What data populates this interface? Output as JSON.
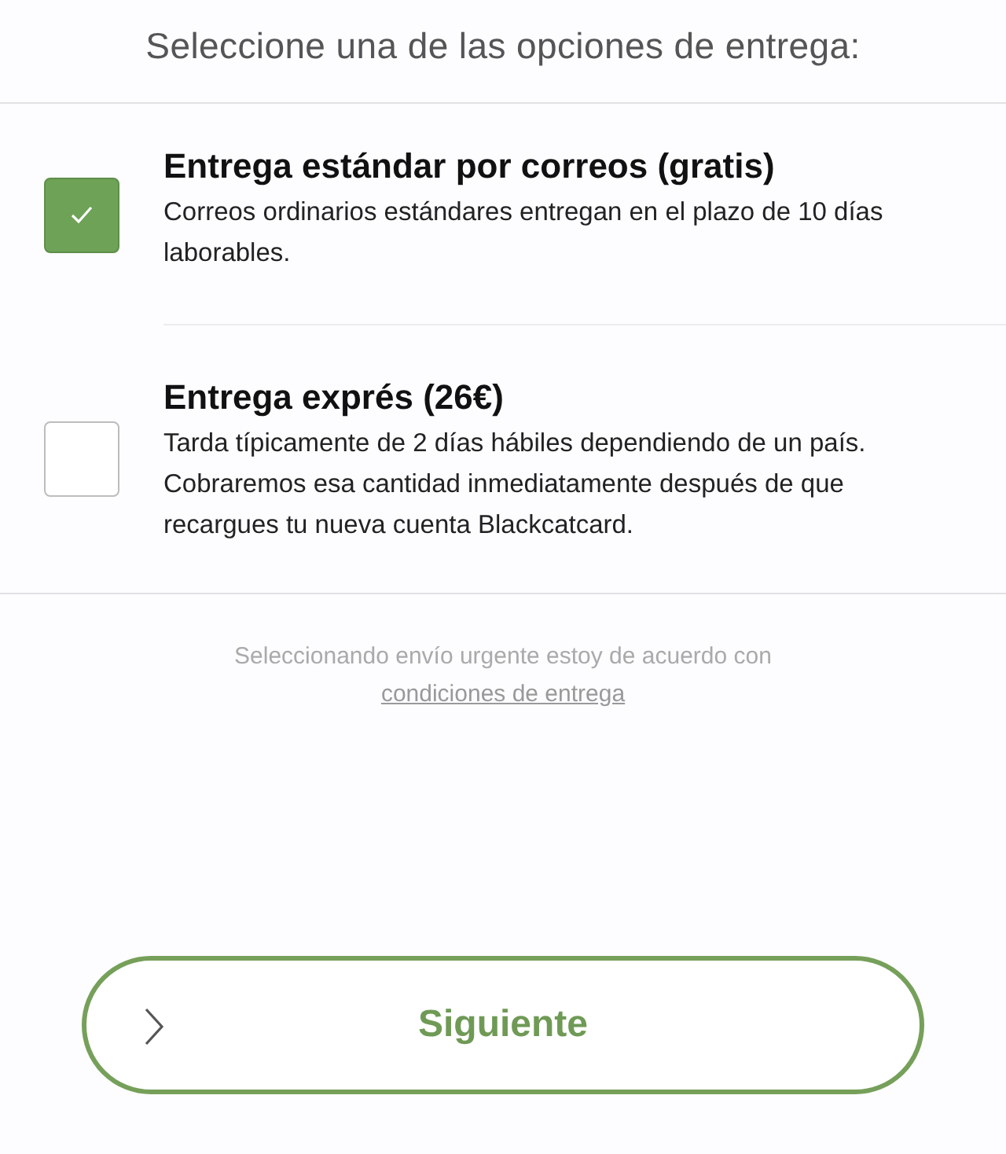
{
  "header": {
    "title": "Seleccione una de las opciones de entrega:"
  },
  "options": [
    {
      "title": "Entrega estándar por correos (gratis)",
      "description": "Correos ordinarios estándares entregan en el plazo de 10 días laborables.",
      "selected": true
    },
    {
      "title": "Entrega exprés (26€)",
      "description": "Tarda típicamente de 2 días hábiles dependiendo de un país. Cobraremos esa cantidad inmediatamente después de que recargues tu nueva cuenta Blackcatcard.",
      "selected": false
    }
  ],
  "note": {
    "text": "Seleccionando envío urgente estoy de acuerdo con",
    "link": "condiciones de entrega"
  },
  "button": {
    "label": "Siguiente"
  }
}
